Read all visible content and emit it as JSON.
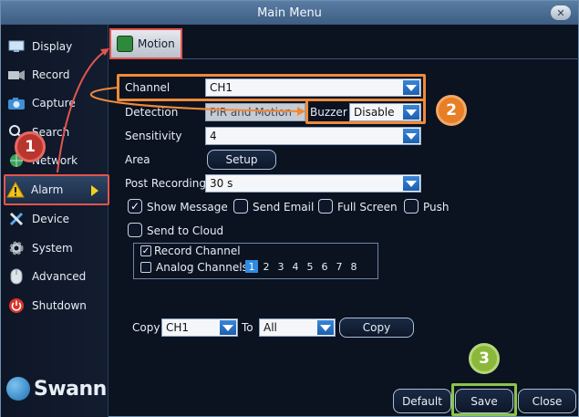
{
  "window": {
    "title": "Main Menu"
  },
  "sidebar": {
    "items": [
      {
        "label": "Display",
        "icon": "display-icon"
      },
      {
        "label": "Record",
        "icon": "record-icon"
      },
      {
        "label": "Capture",
        "icon": "camera-icon"
      },
      {
        "label": "Search",
        "icon": "search-icon"
      },
      {
        "label": "Network",
        "icon": "network-icon"
      },
      {
        "label": "Alarm",
        "icon": "warning-icon"
      },
      {
        "label": "Device",
        "icon": "device-icon"
      },
      {
        "label": "System",
        "icon": "gear-icon"
      },
      {
        "label": "Advanced",
        "icon": "mouse-icon"
      },
      {
        "label": "Shutdown",
        "icon": "power-icon"
      }
    ],
    "active": "Alarm",
    "brand": "Swann"
  },
  "tabs": [
    {
      "label": "Motion",
      "active": true
    }
  ],
  "form": {
    "channel": {
      "label": "Channel",
      "value": "CH1"
    },
    "detection": {
      "label": "Detection",
      "value": "PIR and Motion"
    },
    "buzzer": {
      "label": "Buzzer",
      "value": "Disable"
    },
    "sensitivity": {
      "label": "Sensitivity",
      "value": "4"
    },
    "area": {
      "label": "Area",
      "button": "Setup"
    },
    "post_recording": {
      "label": "Post Recording",
      "value": "30 s"
    },
    "show_message": {
      "label": "Show Message",
      "checked": true
    },
    "send_email": {
      "label": "Send Email",
      "checked": false
    },
    "full_screen": {
      "label": "Full Screen",
      "checked": false
    },
    "push": {
      "label": "Push",
      "checked": false
    },
    "send_to_cloud": {
      "label": "Send to Cloud",
      "checked": false
    },
    "record_channel": {
      "label": "Record Channel",
      "checked": true
    },
    "analog_channels": {
      "label": "Analog Channels",
      "numbers": [
        "1",
        "2",
        "3",
        "4",
        "5",
        "6",
        "7",
        "8"
      ],
      "selected": "1"
    }
  },
  "copy": {
    "label": "Copy",
    "from": "CH1",
    "to_label": "To",
    "to": "All",
    "button": "Copy"
  },
  "footer": {
    "default": "Default",
    "save": "Save",
    "close": "Close"
  },
  "badges": {
    "one": "1",
    "two": "2",
    "three": "3"
  },
  "colors": {
    "annotation_red": "#e2554e",
    "annotation_orange": "#ef8a3a",
    "annotation_green": "#8bc34a",
    "dropdown_blue": "#2f8be0",
    "title_bar": "#4a6d93"
  }
}
